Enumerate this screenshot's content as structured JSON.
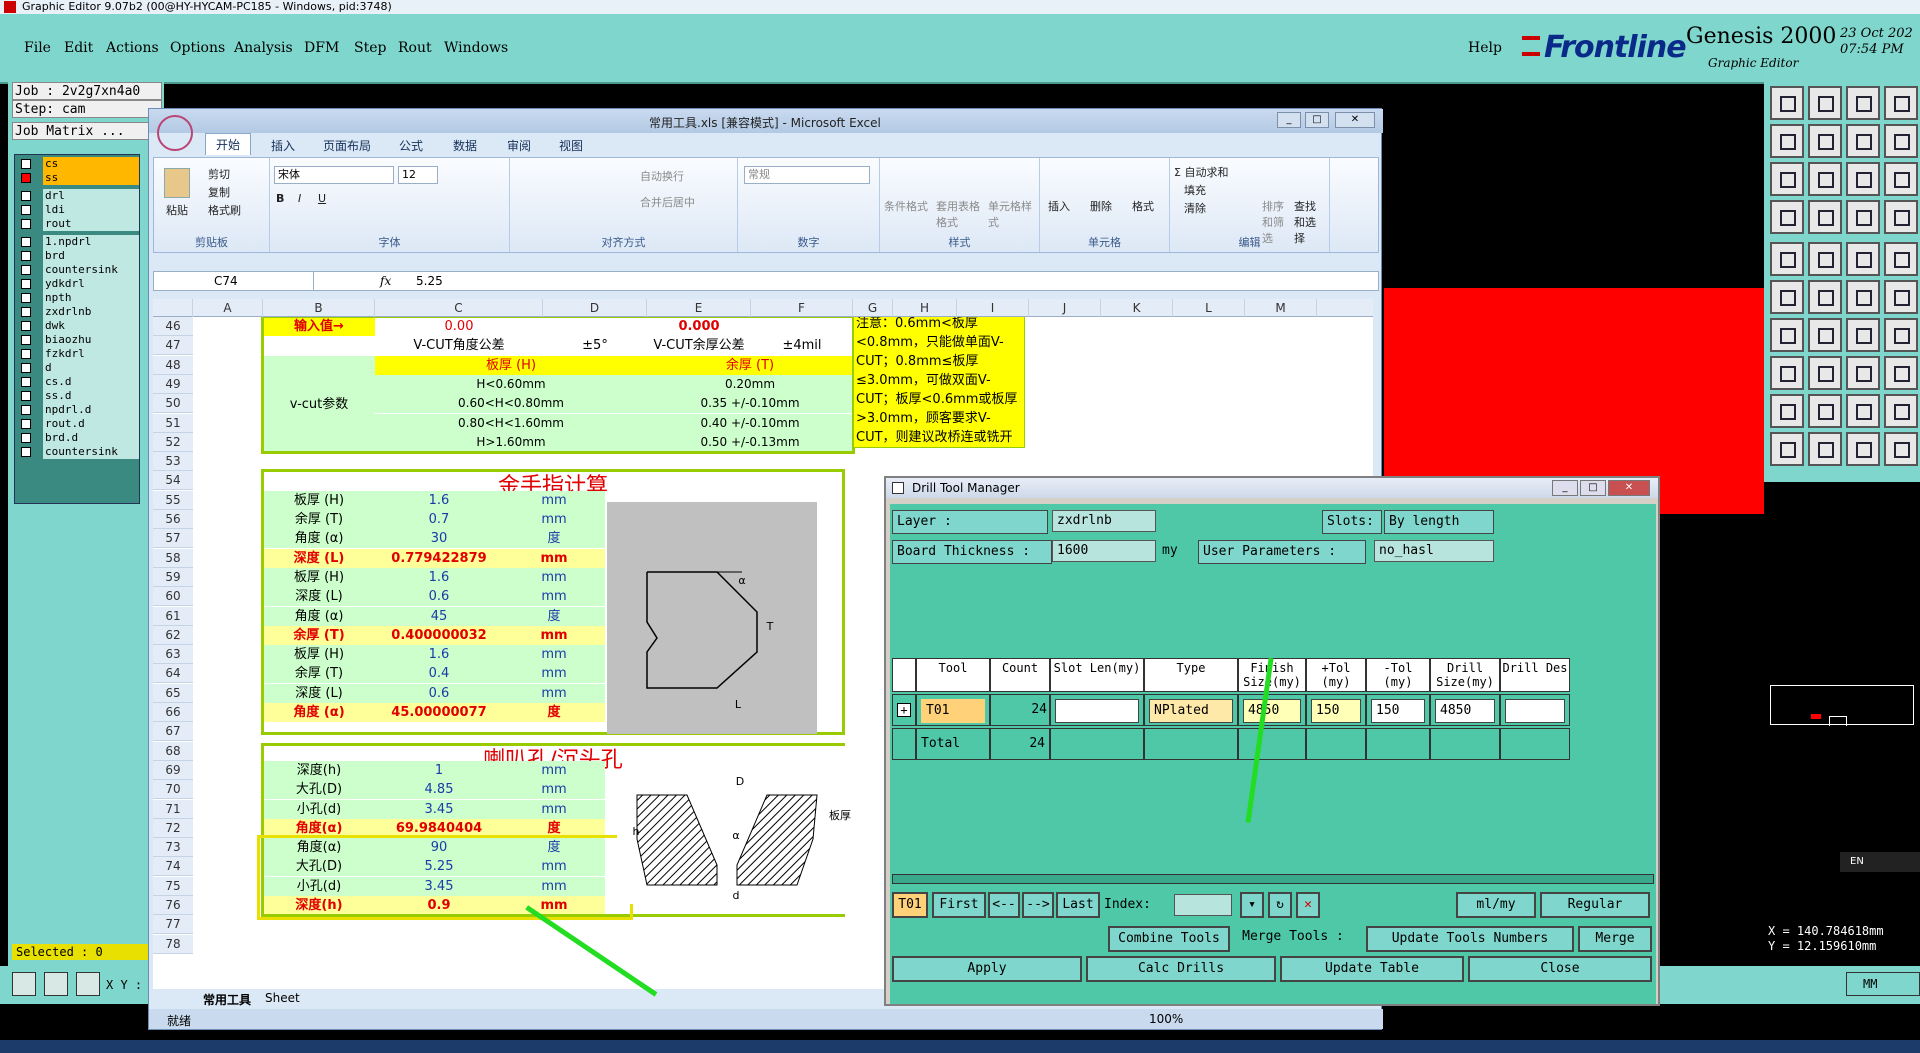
{
  "genesis": {
    "title": "Graphic Editor 9.07b2 (00@HY-HYCAM-PC185 - Windows, pid:3748)",
    "menus": [
      "File",
      "Edit",
      "Actions",
      "Options",
      "Analysis",
      "DFM",
      "Step",
      "Rout",
      "Windows"
    ],
    "help": "Help",
    "brand": "Frontline",
    "product": "Genesis 2000",
    "subproduct": "Graphic Editor",
    "date": "23 Oct 202",
    "time": "07:54 PM",
    "job": "Job : 2v2g7xn4a0",
    "step": "Step: cam",
    "matrix_btn": "Job Matrix ...",
    "layers": [
      "cs",
      "ss",
      "drl",
      "ldi",
      "rout",
      "1.npdrl",
      "brd",
      "countersink",
      "ydkdrl",
      "npth",
      "zxdrlnb",
      "dwk",
      "biaozhu",
      "fzkdrl",
      "d",
      "cs.d",
      "ss.d",
      "npdrl.d",
      "rout.d",
      "brd.d",
      "countersink"
    ],
    "selected": "Selected : 0",
    "xy_label": "X Y :",
    "coord_x": "X = 140.784618mm",
    "coord_y": "Y = 12.159610mm",
    "units_btn": "MM",
    "lang": "EN",
    "accent_red": "#ff0000",
    "panel_color": "#7fd6cc"
  },
  "excel": {
    "title": "常用工具.xls  [兼容模式]  -  Microsoft Excel",
    "tabs": [
      "开始",
      "插入",
      "页面布局",
      "公式",
      "数据",
      "审阅",
      "视图"
    ],
    "clipboard": {
      "paste": "粘贴",
      "cut": "剪切",
      "copy": "复制",
      "painter": "格式刷",
      "group": "剪贴板"
    },
    "font": {
      "name": "宋体",
      "size": "12",
      "group": "字体"
    },
    "align": {
      "wrap": "自动换行",
      "merge": "合并后居中",
      "group": "对齐方式"
    },
    "number": {
      "format": "常规",
      "group": "数字"
    },
    "styles": {
      "cond": "条件格式",
      "table": "套用表格格式",
      "cell": "单元格样式",
      "group": "样式"
    },
    "cells": {
      "insert": "插入",
      "delete": "删除",
      "format": "格式",
      "group": "单元格"
    },
    "edit": {
      "autosum": "Σ 自动求和",
      "fill": "填充",
      "clear": "清除",
      "sort": "排序和筛选",
      "find": "查找和选择",
      "group": "编辑"
    },
    "namebox": "C74",
    "fx": "fx",
    "formula": "5.25",
    "columns": [
      "A",
      "B",
      "C",
      "D",
      "E",
      "F",
      "G",
      "H",
      "I",
      "J",
      "K",
      "L",
      "M"
    ],
    "rows": [
      "46",
      "47",
      "48",
      "49",
      "50",
      "51",
      "52",
      "53",
      "54",
      "55",
      "56",
      "57",
      "58",
      "59",
      "60",
      "61",
      "62",
      "63",
      "64",
      "65",
      "66",
      "67",
      "68",
      "69",
      "70",
      "71",
      "72",
      "73",
      "74",
      "75",
      "76",
      "77",
      "78"
    ],
    "vcut": {
      "input_label": "输入值→",
      "v1": "0.00",
      "v2": "0.000",
      "angle_tol_label": "V-CUT角度公差",
      "angle_tol": "±5°",
      "remain_tol_label": "V-CUT余厚公差",
      "remain_tol": "±4mil",
      "param_label": "v-cut参数",
      "col_thick": "板厚 (H)",
      "col_remain": "余厚 (T)",
      "rows": [
        [
          "H<0.60mm",
          "0.20mm"
        ],
        [
          "0.60<H<0.80mm",
          "0.35 +/-0.10mm"
        ],
        [
          "0.80<H<1.60mm",
          "0.40 +/-0.10mm"
        ],
        [
          "H>1.60mm",
          "0.50 +/-0.13mm"
        ]
      ],
      "note": "注意：0.6mm<板厚<0.8mm，只能做单面V-CUT；0.8mm≤板厚≤3.0mm，可做双面V-CUT；板厚<0.6mm或板厚>3.0mm，顾客要求V-CUT，则建议改桥连或铣开交货！"
    },
    "gold": {
      "title": "金手指计算",
      "rows": [
        [
          "板厚 (H)",
          "1.6",
          "mm",
          "g"
        ],
        [
          "余厚 (T)",
          "0.7",
          "mm",
          "g"
        ],
        [
          "角度 (α)",
          "30",
          "度",
          "g"
        ],
        [
          "深度 (L)",
          "0.779422879",
          "mm",
          "y"
        ],
        [
          "板厚 (H)",
          "1.6",
          "mm",
          "g"
        ],
        [
          "深度 (L)",
          "0.6",
          "mm",
          "g"
        ],
        [
          "角度 (α)",
          "45",
          "度",
          "g"
        ],
        [
          "余厚 (T)",
          "0.400000032",
          "mm",
          "y"
        ],
        [
          "板厚 (H)",
          "1.6",
          "mm",
          "g"
        ],
        [
          "余厚 (T)",
          "0.4",
          "mm",
          "g"
        ],
        [
          "深度 (L)",
          "0.6",
          "mm",
          "g"
        ],
        [
          "角度 (α)",
          "45.00000077",
          "度",
          "y"
        ]
      ],
      "diag_alpha": "α",
      "diag_T": "T",
      "diag_L": "L"
    },
    "horn": {
      "title": "喇叭孔/沉头孔",
      "rows": [
        [
          "深度(h)",
          "1",
          "mm",
          "g"
        ],
        [
          "大孔(D)",
          "4.85",
          "mm",
          "g"
        ],
        [
          "小孔(d)",
          "3.45",
          "mm",
          "g"
        ],
        [
          "角度(α)",
          "69.9840404",
          "度",
          "y"
        ],
        [
          "角度(α)",
          "90",
          "度",
          "g"
        ],
        [
          "大孔(D)",
          "5.25",
          "mm",
          "g"
        ],
        [
          "小孔(d)",
          "3.45",
          "mm",
          "g"
        ],
        [
          "深度(h)",
          "0.9",
          "mm",
          "y"
        ]
      ],
      "diag_D": "D",
      "diag_d": "d",
      "diag_a": "α",
      "diag_h": "h",
      "diag_side": "板厚"
    },
    "sheet_tabs": [
      "常用工具",
      "Sheet"
    ],
    "status": "就绪",
    "zoom": "100%"
  },
  "dtm": {
    "title": "Drill Tool Manager",
    "layer_label": "Layer          :",
    "layer_value": "zxdrlnb",
    "slots_label": "Slots:",
    "slots_value": "By length",
    "thick_label": "Board Thickness :",
    "thick_value": "1600",
    "thick_unit": "my",
    "userparam_label": "User Parameters :",
    "userparam_value": "no_hasl",
    "headers": [
      "Tool",
      "Count",
      "Slot Len(my)",
      "Type",
      "Finish Size(my)",
      "+Tol (my)",
      "-Tol (my)",
      "Drill Size(my)",
      "Drill Des"
    ],
    "row": {
      "tool": "T01",
      "count": "24",
      "slot": "",
      "type": "NPlated",
      "finish": "4850",
      "ptol": "150",
      "ntol": "150",
      "drill": "4850",
      "des": ""
    },
    "total_label": "Total",
    "total_count": "24",
    "nav": {
      "cur": "T01",
      "first": "First",
      "prev": "<--",
      "next": "-->",
      "last": "Last",
      "index": "Index:",
      "units": "ml/my",
      "mode": "Regular"
    },
    "buttons": {
      "combine": "Combine Tools",
      "merge_label": "Merge Tools :",
      "update_nums": "Update Tools Numbers",
      "merge": "Merge",
      "apply": "Apply",
      "calc": "Calc Drills",
      "update_table": "Update Table",
      "close": "Close"
    }
  },
  "highlight_color": "#22dd22"
}
